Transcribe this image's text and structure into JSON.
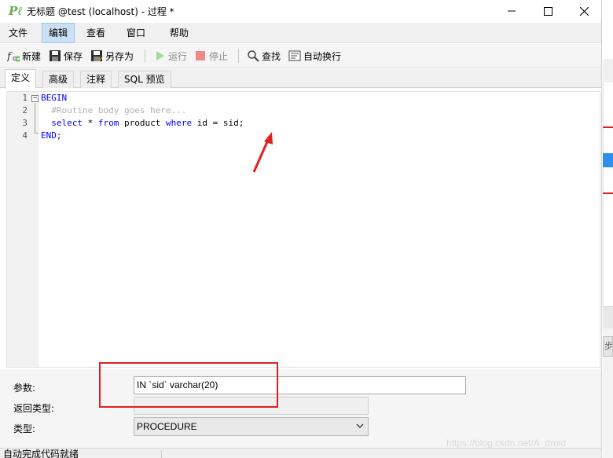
{
  "window": {
    "app_icon": "Pℓ",
    "title": "无标题 @test (localhost) - 过程 *"
  },
  "menu": [
    "文件",
    "编辑",
    "查看",
    "窗口",
    "帮助"
  ],
  "toolbar": {
    "new": "新建",
    "save": "保存",
    "save_as": "另存为",
    "run": "运行",
    "stop": "停止",
    "find": "查找",
    "word_wrap": "自动换行"
  },
  "tabs": [
    "定义",
    "高级",
    "注释",
    "SQL 预览"
  ],
  "editor": {
    "line_numbers": [
      "1",
      "2",
      "3",
      "4"
    ],
    "line1": "BEGIN",
    "line2": "  #Routine body goes here...",
    "line3_kw1": "  select",
    "line3_a": " * ",
    "line3_kw2": "from",
    "line3_b": " product ",
    "line3_kw3": "where",
    "line3_c": " id = sid;",
    "line4": "END;"
  },
  "properties": {
    "params_label": "参数:",
    "params_value": "IN `sid` varchar(20)",
    "return_type_label": "返回类型:",
    "return_type_value": "",
    "type_label": "类型:",
    "type_value": "PROCEDURE"
  },
  "status": {
    "text": "自动完成代码就绪"
  },
  "background_window": {
    "partial_text": "步"
  },
  "watermark": "https://blog.csdn.net/A_droid",
  "colors": {
    "keyword": "#0000ff",
    "comment": "#b0b0b0",
    "annotation": "#e02020",
    "active_menu": "#cce0f5"
  }
}
